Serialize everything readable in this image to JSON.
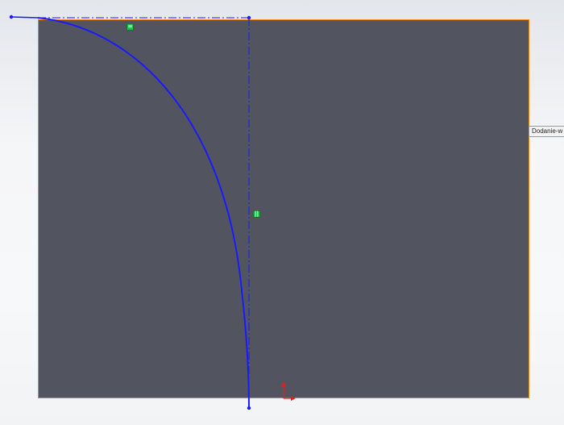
{
  "canvas": {
    "tooltip_text": "Dodanie-w",
    "relations": {
      "horizontal_symbol": "=",
      "vertical_symbol": "||"
    },
    "colors": {
      "background": "#f5f6f8",
      "plane_fill": "#525460",
      "plane_border": "#f08a10",
      "sketch_line": "#1a1aff",
      "relation_badge": "#21c24a",
      "origin_red": "#e02020"
    },
    "icons": [
      "horizontal-relation-icon",
      "vertical-relation-icon",
      "origin-icon"
    ]
  }
}
